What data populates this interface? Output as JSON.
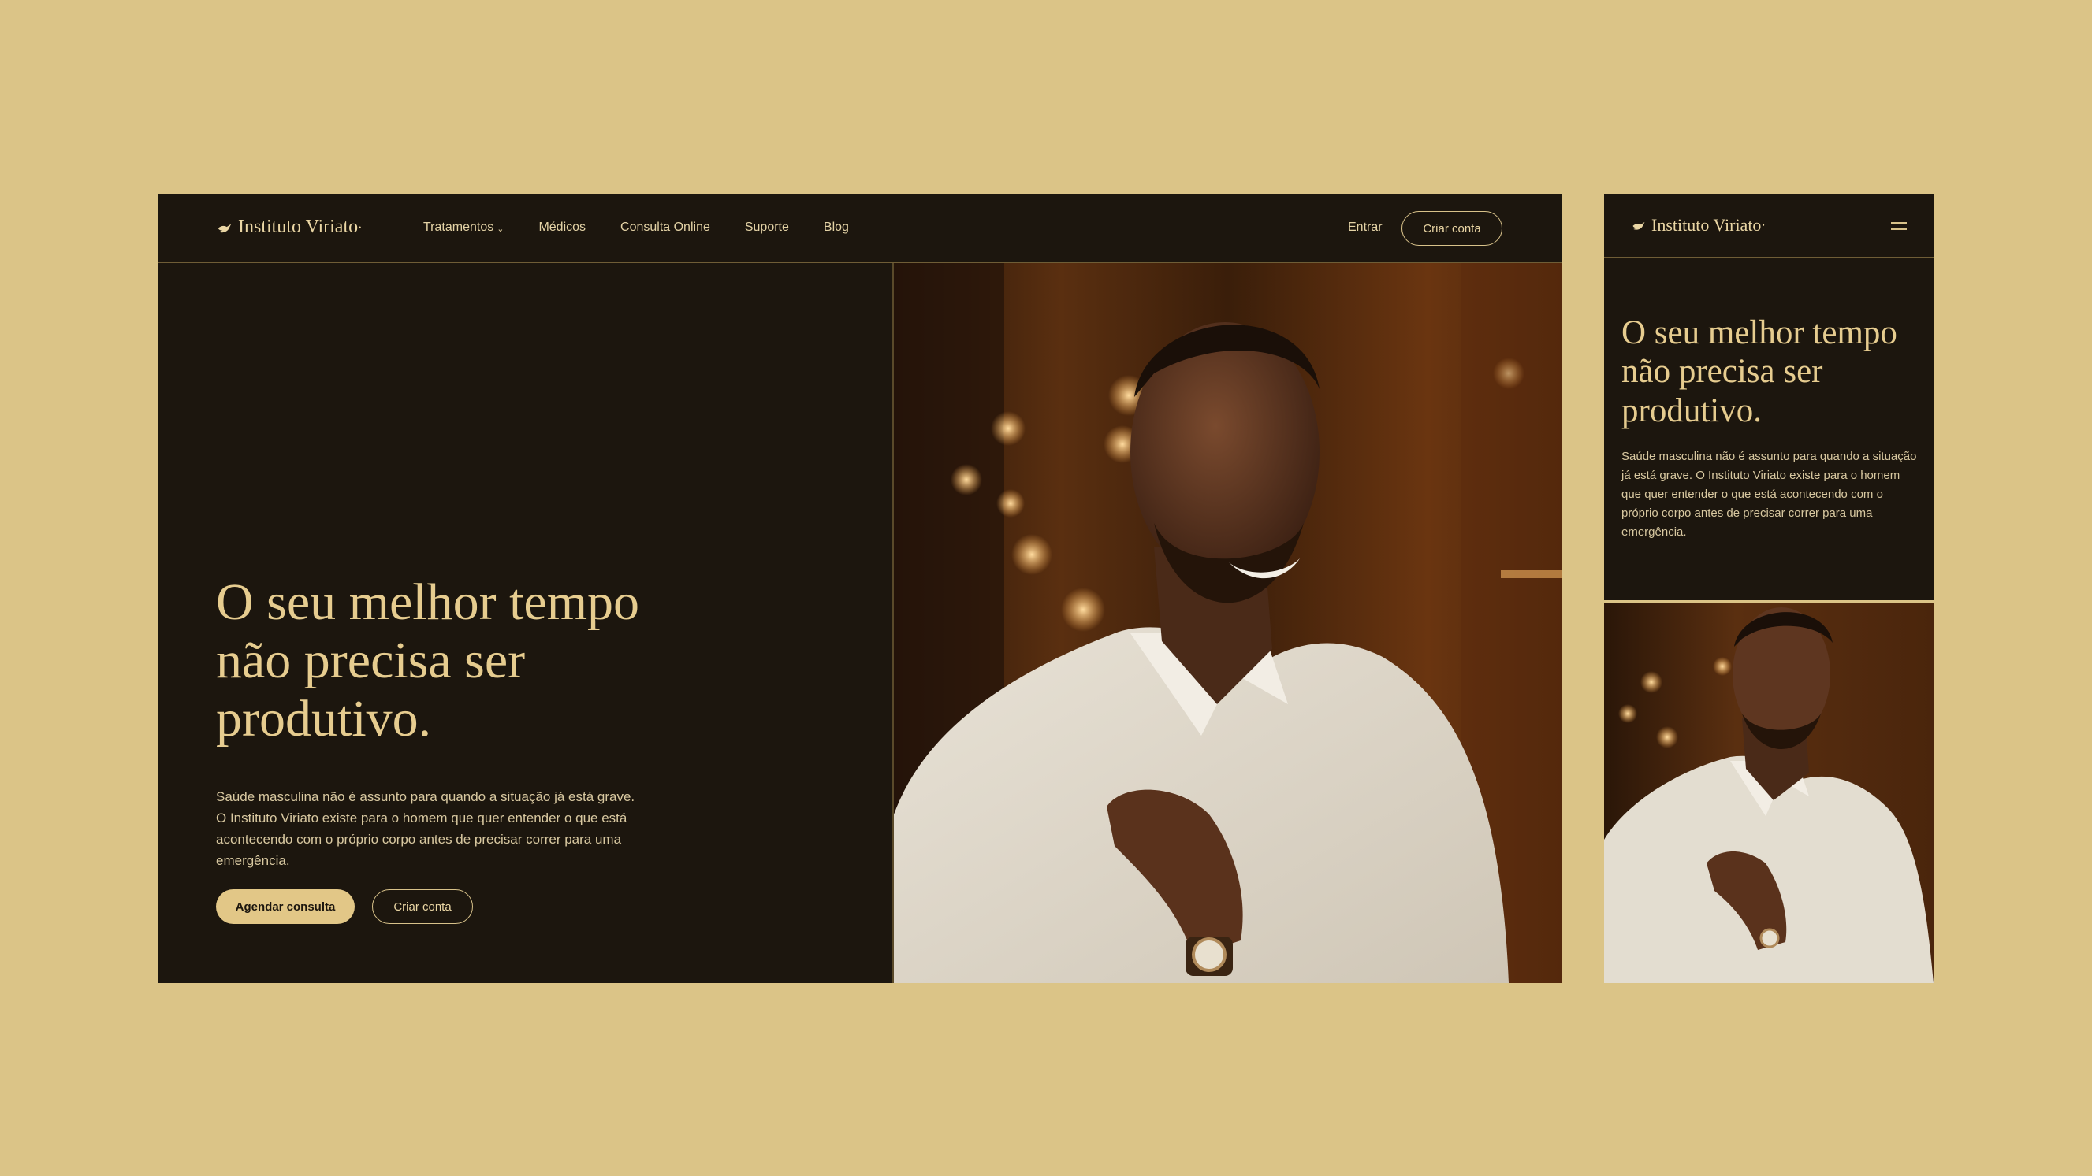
{
  "colors": {
    "background": "#dbc487",
    "panel": "#1c160e",
    "accent": "#e2c787",
    "text_light": "#d8c8a0"
  },
  "brand": {
    "name": "Instituto Viriato",
    "mark": "•",
    "icon": "bird-swoosh-icon"
  },
  "nav": {
    "items": [
      "Tratamentos",
      "Médicos",
      "Consulta Online",
      "Suporte",
      "Blog"
    ],
    "dropdown_icon": "chevron-down-icon",
    "login": "Entrar",
    "signup": "Criar conta"
  },
  "hero": {
    "headline": "O seu melhor tempo não precisa ser produtivo.",
    "body": "Saúde masculina não é assunto para quando a situação já está grave. O Instituto Viriato existe para o homem que quer entender o que está acontecendo com o próprio corpo antes de precisar correr para uma emergência.",
    "primary_cta": "Agendar consulta",
    "secondary_cta": "Criar conta",
    "image_alt": "Homem sorrindo com camisa polo branca em ambiente de bar aconchegante"
  },
  "mobile": {
    "menu_icon": "hamburger-menu-icon"
  }
}
